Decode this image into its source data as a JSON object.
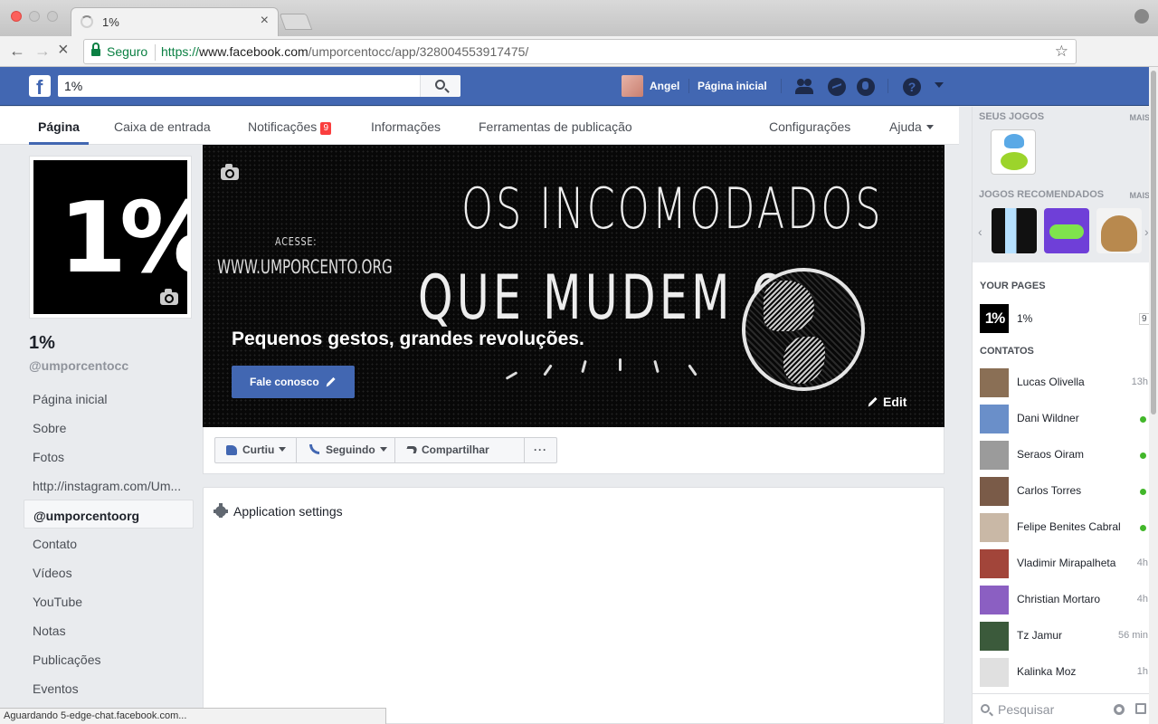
{
  "browser": {
    "tab_title": "1%",
    "secure_label": "Seguro",
    "url_scheme": "https://",
    "url_host": "www.facebook.com",
    "url_path": "/umporcentocc/app/328004553917475/",
    "status_text": "Aguardando 5-edge-chat.facebook.com..."
  },
  "fb_header": {
    "search_value": "1%",
    "user_name": "Angel",
    "home_label": "Página inicial"
  },
  "page_nav": {
    "items": [
      "Página",
      "Caixa de entrada",
      "Notificações",
      "Informações",
      "Ferramentas de publicação"
    ],
    "notifications_badge": "9",
    "settings_label": "Configurações",
    "help_label": "Ajuda"
  },
  "page": {
    "profile_text": "1%",
    "name": "1%",
    "handle": "@umporcentocc",
    "left_nav": [
      "Página inicial",
      "Sobre",
      "Fotos",
      "http://instagram.com/Um...",
      "@umporcentoorg",
      "Contato",
      "Vídeos",
      "YouTube",
      "Notas",
      "Publicações",
      "Eventos"
    ],
    "left_nav_active_index": 4
  },
  "cover": {
    "headline_line1": "OS INCOMODADOS",
    "headline_line2": "QUE MUDEM O",
    "acesse": "ACESSE:",
    "site": "WWW.UMPORCENTO.ORG",
    "tagline": "Pequenos gestos, grandes revoluções.",
    "cta_label": "Fale conosco",
    "edit_label": "Edit"
  },
  "actions": {
    "like_label": "Curtiu",
    "follow_label": "Seguindo",
    "share_label": "Compartilhar",
    "more_label": "···"
  },
  "app_settings": {
    "title": "Application settings"
  },
  "sidebar": {
    "your_games_label": "SEUS JOGOS",
    "recommended_games_label": "JOGOS RECOMENDADOS",
    "more_label": "MAIS",
    "your_pages_label": "YOUR PAGES",
    "your_page_icon_text": "1%",
    "your_page_name": "1%",
    "your_page_count": "9",
    "contacts_label": "CONTATOS",
    "contacts": [
      {
        "name": "Lucas Olivella",
        "status": "13h",
        "online": false,
        "color": "#8a6f55"
      },
      {
        "name": "Dani Wildner",
        "status": "",
        "online": true,
        "color": "#6a8fc9"
      },
      {
        "name": "Seraos Oiram",
        "status": "",
        "online": true,
        "color": "#9b9b9b"
      },
      {
        "name": "Carlos Torres",
        "status": "",
        "online": true,
        "color": "#7a5b48"
      },
      {
        "name": "Felipe Benites Cabral",
        "status": "",
        "online": true,
        "color": "#c9b8a6"
      },
      {
        "name": "Vladimir Mirapalheta",
        "status": "4h",
        "online": false,
        "color": "#a2453a"
      },
      {
        "name": "Christian Mortaro",
        "status": "4h",
        "online": false,
        "color": "#8b5fc2"
      },
      {
        "name": "Tz Jamur",
        "status": "56 min",
        "online": false,
        "color": "#3b5a3b"
      },
      {
        "name": "Kalinka Moz",
        "status": "1h",
        "online": false,
        "color": "#e0e0e0"
      }
    ],
    "search_placeholder": "Pesquisar"
  }
}
